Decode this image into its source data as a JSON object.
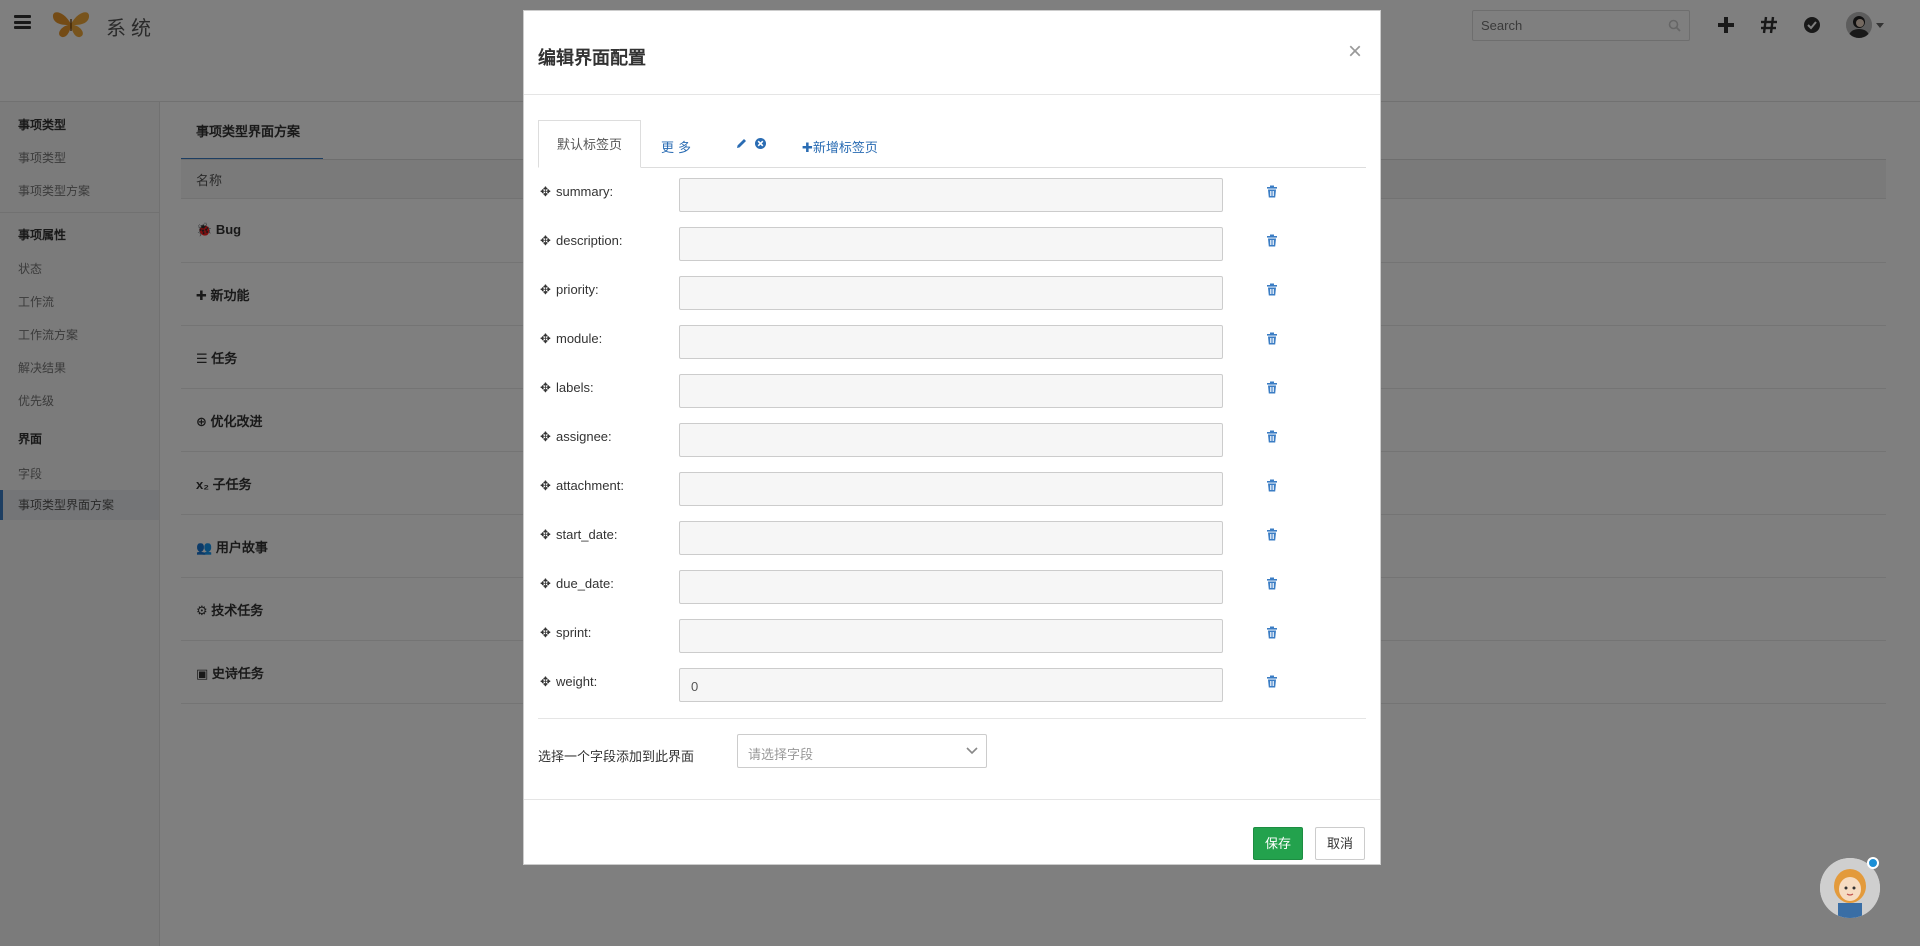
{
  "app": {
    "title": "系统"
  },
  "topbar": {
    "search_placeholder": "Search",
    "icons": [
      "plus-icon",
      "hash-icon",
      "check-circle-icon",
      "avatar",
      "caret-down-icon"
    ]
  },
  "sidebar": {
    "sections": [
      {
        "heading": "事项类型",
        "items": [
          "事项类型",
          "事项类型方案"
        ]
      },
      {
        "heading": "事项属性",
        "items": [
          "状态",
          "工作流",
          "工作流方案",
          "解决结果",
          "优先级"
        ]
      },
      {
        "heading": "界面",
        "items": [
          "字段",
          "事项类型界面方案"
        ]
      }
    ],
    "active_item": "事项类型界面方案"
  },
  "main": {
    "tab": "事项类型界面方案",
    "column_header": "名称",
    "rows": [
      {
        "icon": "bug-icon",
        "label": "Bug"
      },
      {
        "icon": "plus-icon",
        "label": "新功能"
      },
      {
        "icon": "list-icon",
        "label": "任务"
      },
      {
        "icon": "arrow-up-circle-icon",
        "label": "优化改进"
      },
      {
        "icon": "subscript-icon",
        "label": "子任务"
      },
      {
        "icon": "users-icon",
        "label": "用户故事"
      },
      {
        "icon": "cogs-icon",
        "label": "技术任务"
      },
      {
        "icon": "book-icon",
        "label": "史诗任务"
      }
    ]
  },
  "modal": {
    "title": "编辑界面配置",
    "close": "×",
    "tabs": {
      "active": "默认标签页",
      "more": "更多",
      "add": "新增标签页"
    },
    "fields": [
      {
        "label": "summary:",
        "value": ""
      },
      {
        "label": "description:",
        "value": ""
      },
      {
        "label": "priority:",
        "value": ""
      },
      {
        "label": "module:",
        "value": ""
      },
      {
        "label": "labels:",
        "value": ""
      },
      {
        "label": "assignee:",
        "value": ""
      },
      {
        "label": "attachment:",
        "value": ""
      },
      {
        "label": "start_date:",
        "value": ""
      },
      {
        "label": "due_date:",
        "value": ""
      },
      {
        "label": "sprint:",
        "value": ""
      },
      {
        "label": "weight:",
        "value": "0"
      }
    ],
    "add_field_label": "选择一个字段添加到此界面",
    "select_placeholder": "请选择字段",
    "save": "保存",
    "cancel": "取消"
  },
  "colors": {
    "primary": "#3b7dc4",
    "link": "#2a6cb3",
    "save": "#23a24d",
    "overlay": "rgba(0,0,0,0.5)"
  }
}
